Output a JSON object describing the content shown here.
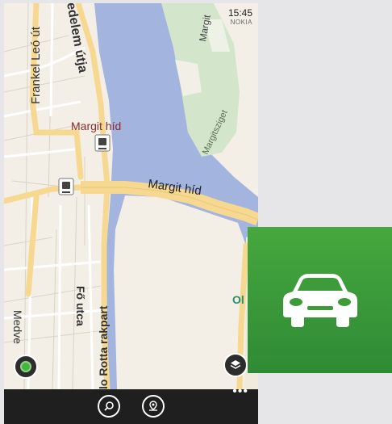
{
  "status": {
    "time": "15:45",
    "brand": "NOKIA"
  },
  "map": {
    "labels": {
      "frankel": "Frankel Leó út",
      "hadelem": "edelem útja",
      "margit_hid_station": "Margit híd",
      "margit_hid_bridge": "Margit híd",
      "margitsziget": "Margitsziget",
      "margit_top": "Margit",
      "fo_utca": "Fő utca",
      "rotta": "lo Rotta rakpart",
      "medve": "Medve",
      "ol": "Ol"
    }
  },
  "appbar": {
    "more": "•••"
  },
  "tile": {
    "icon": "car-icon",
    "color": "#3e9b3a"
  }
}
